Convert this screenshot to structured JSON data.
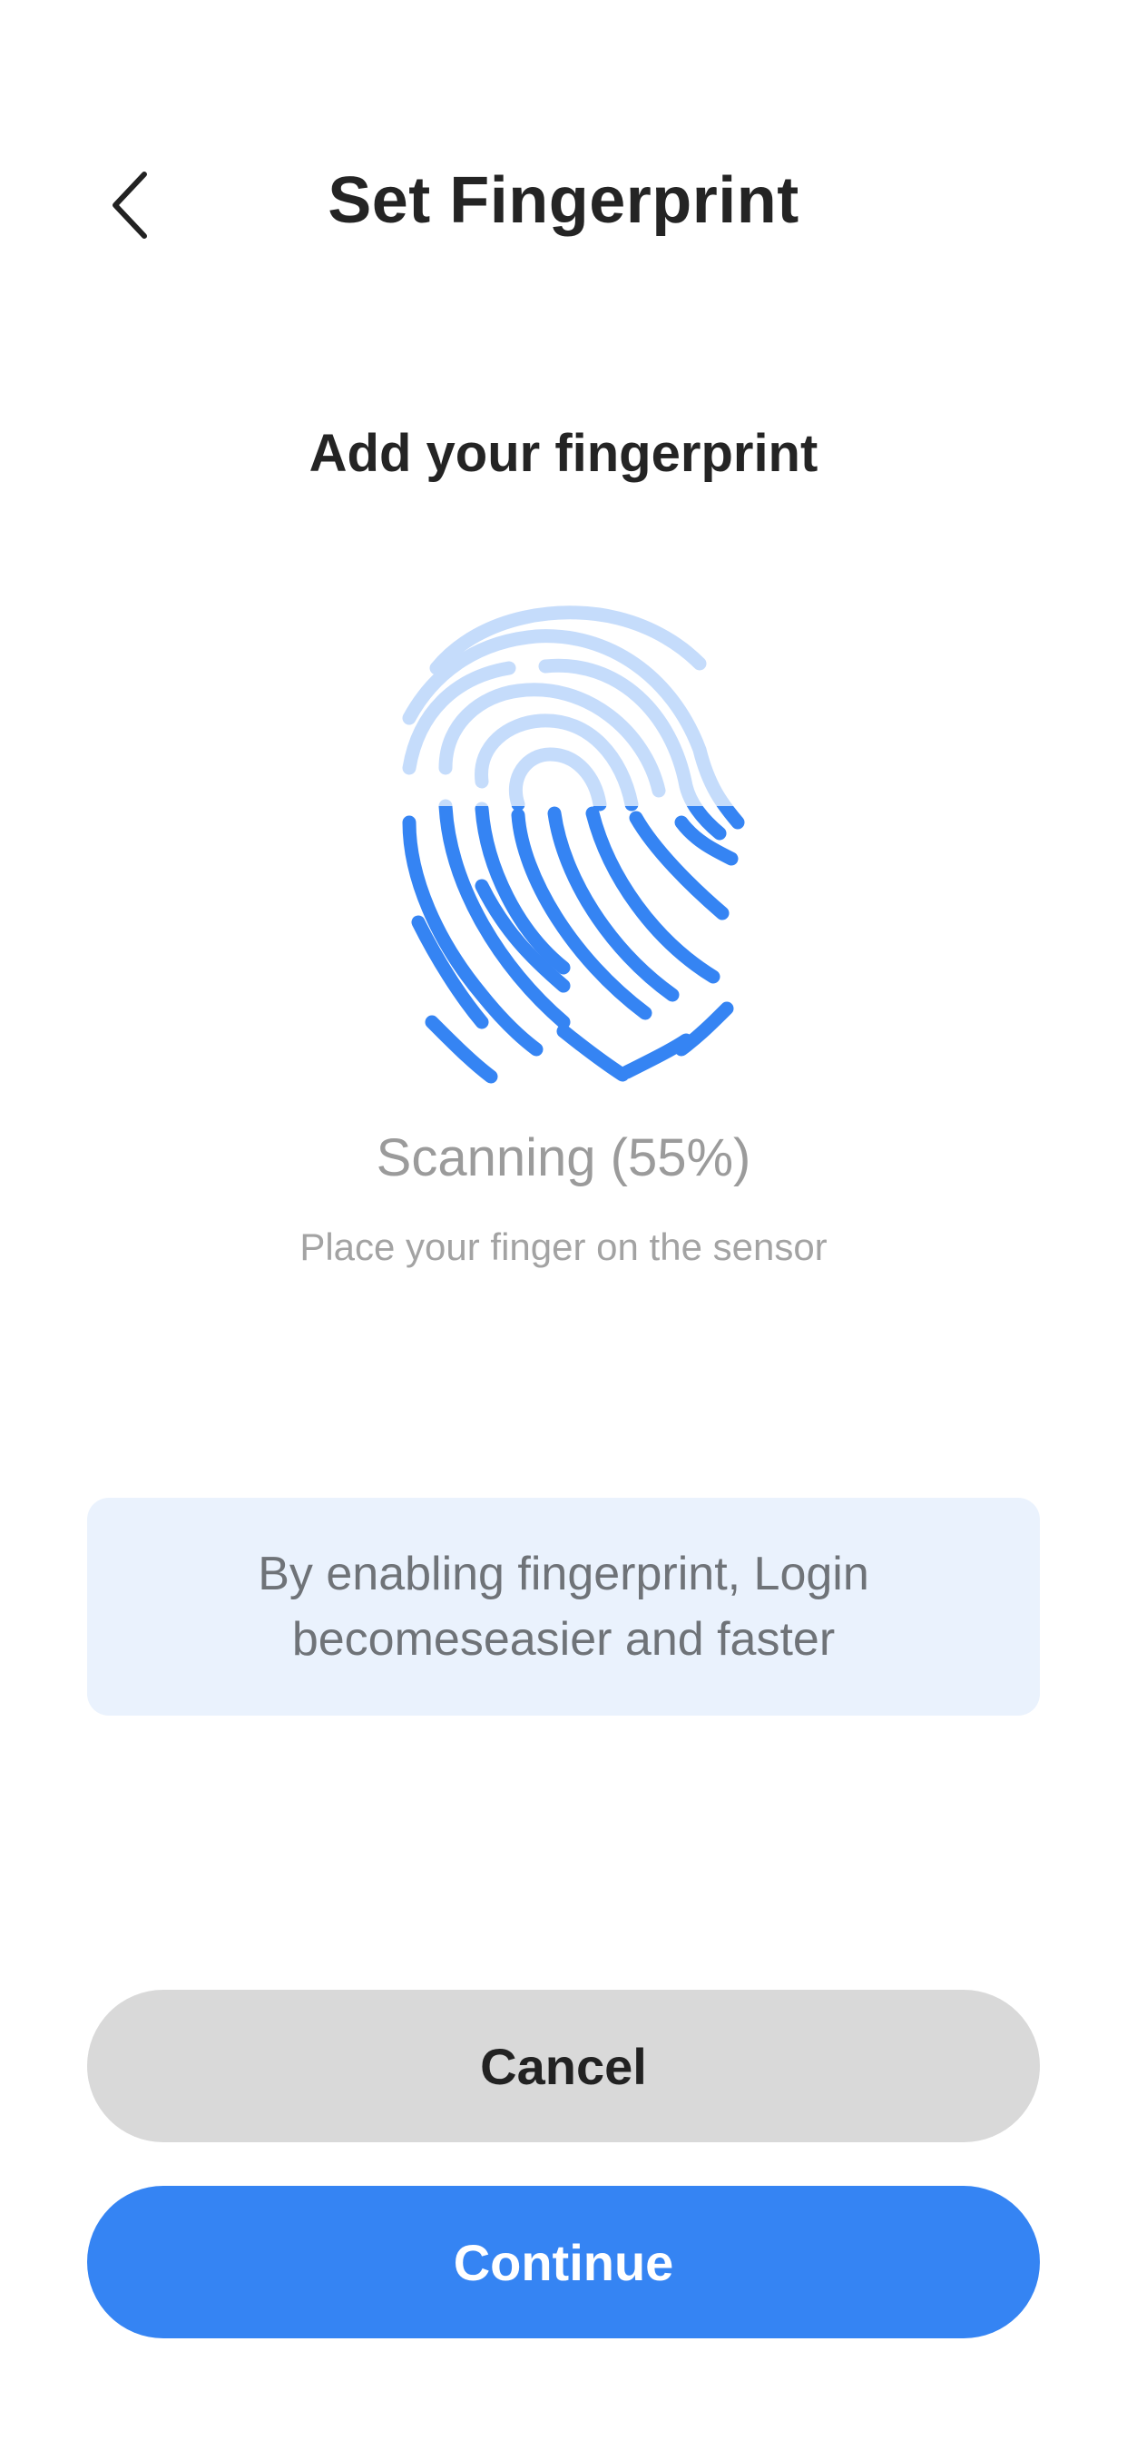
{
  "header": {
    "title": "Set Fingerprint",
    "back_icon": "chevron-left-icon"
  },
  "section": {
    "heading": "Add your fingerprint"
  },
  "fingerprint": {
    "icon": "fingerprint-icon",
    "progress_fraction": 0.55,
    "filled_color": "#3584f3",
    "unfilled_color": "#c5dcfb"
  },
  "status": {
    "label": "Scanning (55%)",
    "hint": "Place your finger on the sensor"
  },
  "info_box": {
    "text": "By enabling fingerprint, Login becomeseasier and faster",
    "background": "#eaf2fd"
  },
  "actions": {
    "cancel_label": "Cancel",
    "continue_label": "Continue",
    "primary_color": "#3584f3",
    "secondary_color": "#d9d9d9"
  }
}
